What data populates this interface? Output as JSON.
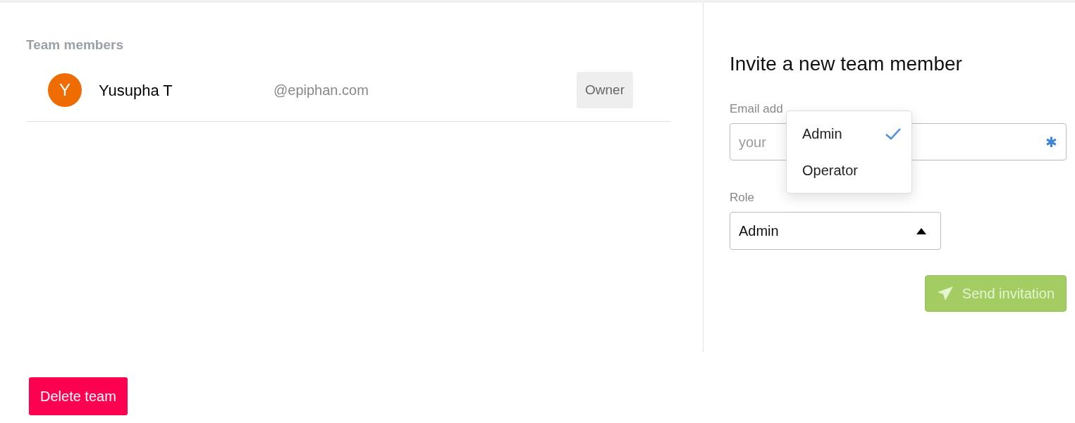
{
  "members_heading": "Team members",
  "members": [
    {
      "initial": "Y",
      "name": "Yusupha T",
      "email": "@epiphan.com",
      "role": "Owner",
      "color": "#ef6c00"
    }
  ],
  "invite": {
    "title": "Invite a new team member",
    "email_label": "Email add",
    "email_placeholder": "your",
    "email_required_mark": "✱",
    "role_label": "Role",
    "role_value": "Admin",
    "role_expanded": true,
    "role_options": [
      {
        "label": "Admin",
        "selected": true
      },
      {
        "label": "Operator",
        "selected": false
      }
    ],
    "send_button": {
      "label": "Send invitation",
      "disabled": true
    }
  },
  "delete_button": "Delete team"
}
